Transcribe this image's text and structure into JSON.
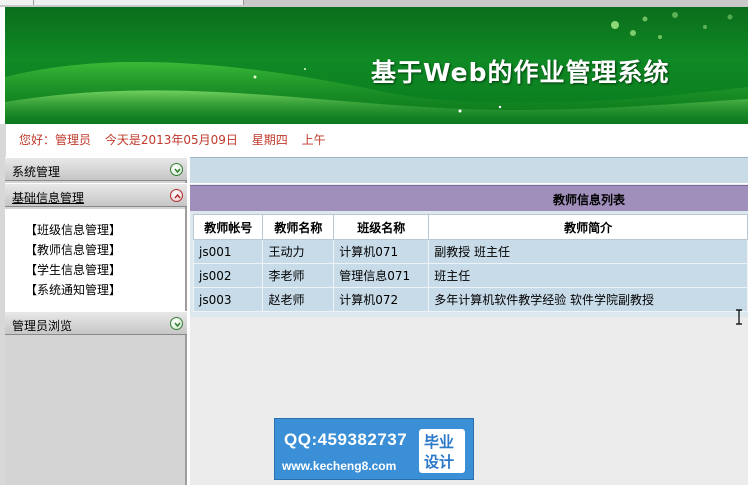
{
  "banner": {
    "title": "基于Web的作业管理系统"
  },
  "greeting": {
    "hello": "您好：管理员",
    "date": "今天是2013年05月09日",
    "weekday": "星期四",
    "period": "上午"
  },
  "sidebar": {
    "menus": [
      {
        "label": "系统管理",
        "expanded": false
      },
      {
        "label": "基础信息管理",
        "expanded": true
      },
      {
        "label": "管理员浏览",
        "expanded": false
      }
    ],
    "items": [
      {
        "label": "【班级信息管理】"
      },
      {
        "label": "【教师信息管理】"
      },
      {
        "label": "【学生信息管理】"
      },
      {
        "label": "【系统通知管理】"
      }
    ]
  },
  "panel": {
    "title": "教师信息列表",
    "columns": [
      "教师帐号",
      "教师名称",
      "班级名称",
      "教师简介"
    ],
    "rows": [
      {
        "account": "js001",
        "name": "王动力",
        "class_name": "计算机071",
        "intro": "副教授 班主任"
      },
      {
        "account": "js002",
        "name": "李老师",
        "class_name": "管理信息071",
        "intro": "班主任"
      },
      {
        "account": "js003",
        "name": "赵老师",
        "class_name": "计算机072",
        "intro": "多年计算机软件教学经验 软件学院副教授"
      }
    ]
  },
  "watermark": {
    "qq": "QQ:459382737",
    "url": "www.kecheng8.com",
    "badge_line1": "毕业",
    "badge_line2": "设计"
  },
  "colors": {
    "banner_green": "#0f8a25",
    "panel_header": "#a08fbb",
    "row_bg": "#c8dbe8",
    "greeting_text": "#c0392b"
  }
}
